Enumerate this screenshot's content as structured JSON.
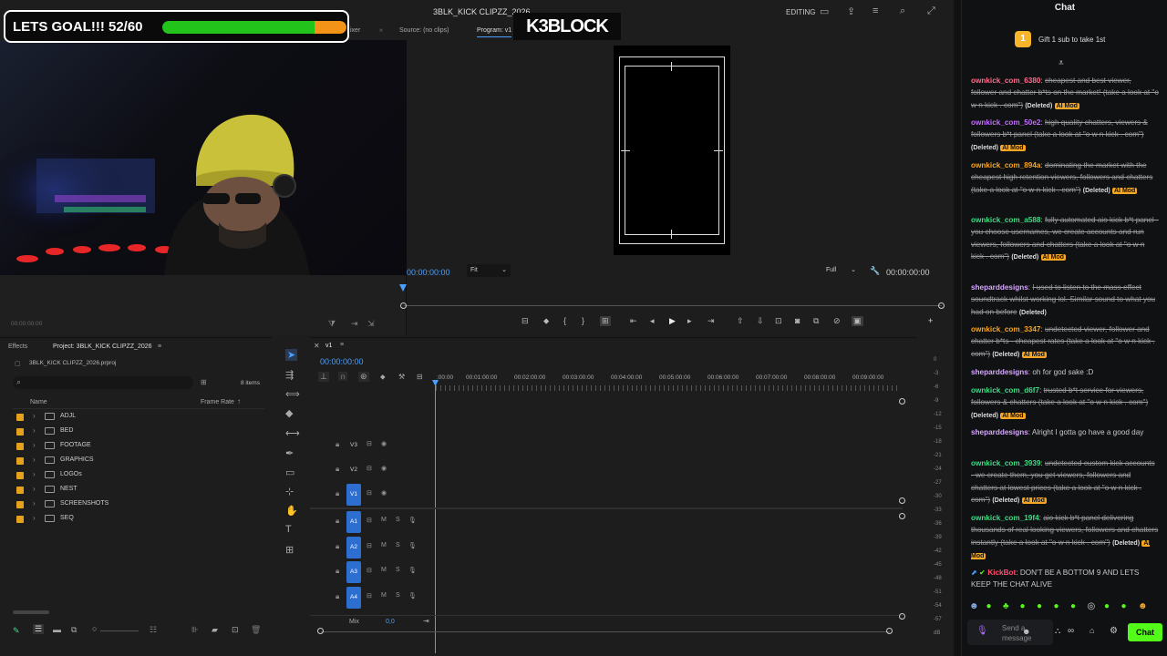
{
  "goal": {
    "text": "LETS GOAL!!! 52/60",
    "current": 52,
    "target": 60
  },
  "logo": {
    "text": "K3BLOCK"
  },
  "editor": {
    "title": "3BLK_KICK CLIPZZ_2026",
    "mode": "EDITING",
    "tabs": {
      "mixer": "ixer",
      "source": "Source: (no clips)",
      "program": "Program: v1"
    },
    "program_timecode": "00:00:00:00",
    "program_end_timecode": "00:00:00:00",
    "fit": "Fit",
    "quality": "Full",
    "source_timecode": "00:00:00:00"
  },
  "project": {
    "tab_effects": "Effects",
    "tab_project": "Project: 3BLK_KICK CLIPZZ_2026",
    "file": "3BLK_KICK CLIPZZ_2026.prproj",
    "count": "8 items",
    "col_name": "Name",
    "col_framerate": "Frame Rate",
    "folders": [
      "ADJL",
      "BED",
      "FOOTAGE",
      "GRAPHICS",
      "LOGOs",
      "NEST",
      "SCREENSHOTS",
      "SEQ"
    ]
  },
  "timeline": {
    "sequence": "v1",
    "timecode": "00:00:00:00",
    "ruler": [
      ":00:00",
      "00:01:00:00",
      "00:02:00:00",
      "00:03:00:00",
      "00:04:00:00",
      "00:05:00:00",
      "00:06:00:00",
      "00:07:00:00",
      "00:08:00:00",
      "00:09:00:00"
    ],
    "video_tracks": [
      "V3",
      "V2",
      "V1"
    ],
    "audio_tracks": [
      "A1",
      "A2",
      "A3",
      "A4"
    ],
    "mix_label": "Mix",
    "mix_value": "0,0",
    "meter_scale": [
      "0",
      "-3",
      "-6",
      "-9",
      "-12",
      "-15",
      "-18",
      "-21",
      "-24",
      "-27",
      "-30",
      "-33",
      "-36",
      "-39",
      "-42",
      "-45",
      "-48",
      "-51",
      "-54",
      "-57",
      "dB"
    ]
  },
  "chat": {
    "title": "Chat",
    "gift": {
      "rank": "1",
      "text": "Gift 1 sub to take 1st"
    },
    "messages": [
      {
        "user": "ownkick_com_6380",
        "color": "#ff6b8b",
        "text": "cheapest and best viewer, follower and chatter b*ts on the market! (take a look at \"o w n kick . com\")",
        "deleted": true
      },
      {
        "user": "ownkick_com_50e2",
        "color": "#c46bff",
        "text": "high quality chatters, viewers & followers b*t panel (take a look at \"o w n kick . com\")",
        "deleted": true
      },
      {
        "user": "ownkick_com_894a",
        "color": "#f5a623",
        "text": "dominating the market with the cheapest high retention viewers, followers and chatters (take a look at \"o w n kick . com\")",
        "deleted": true
      },
      {
        "user": "ownkick_com_a588",
        "color": "#3ddc84",
        "text": "fully automated aio kick b*t panel - you choose usernames, we create accounts and run viewers, followers and chatters (take a look at \"o w n kick . com\")",
        "deleted": true
      },
      {
        "user": "sheparddesigns",
        "color": "#d7a6ff",
        "text": "I used to listen to the mass effect soundtrack whilst working lol. Similar sound to what you had on before",
        "deleted": true
      },
      {
        "user": "ownkick_com_3347",
        "color": "#f5a623",
        "text": "undetected viewer, follower and chatter b*ts - cheapest rates (take a look at \"o w n kick . com\")",
        "deleted": true
      },
      {
        "user": "sheparddesigns",
        "color": "#d7a6ff",
        "text": "oh for god sake :D",
        "deleted": false
      },
      {
        "user": "ownkick_com_d6f7",
        "color": "#3ddc84",
        "text": "trusted b*t service for viewers, followers & chatters (take a look at \"o w n kick . com\")",
        "deleted": true
      },
      {
        "user": "sheparddesigns",
        "color": "#d7a6ff",
        "text": "Alright I gotta go have a good day",
        "deleted": false
      },
      {
        "user": "ownkick_com_3939",
        "color": "#3ddc84",
        "text": "undetected custom kick accounts - we create them, you get viewers, followers and chatters at lowest prices (take a look at \"o w n kick . com\")",
        "deleted": true
      },
      {
        "user": "ownkick_com_19f4",
        "color": "#3ddc84",
        "text": "aio kick b*t panel delivering thousands of real looking viewers, followers and chatters instantly (take a look at \"o w n kick . com\")",
        "deleted": true
      },
      {
        "user": "KickBot",
        "color": "#ff4d6d",
        "text": "DON'T BE A BOTTOM 9 AND LETS KEEP THE CHAT ALIVE",
        "deleted": false
      }
    ],
    "deleted_label": "(Deleted)",
    "ai_badge": "AI Mod",
    "input_placeholder": "Send a message",
    "send_label": "Chat"
  }
}
